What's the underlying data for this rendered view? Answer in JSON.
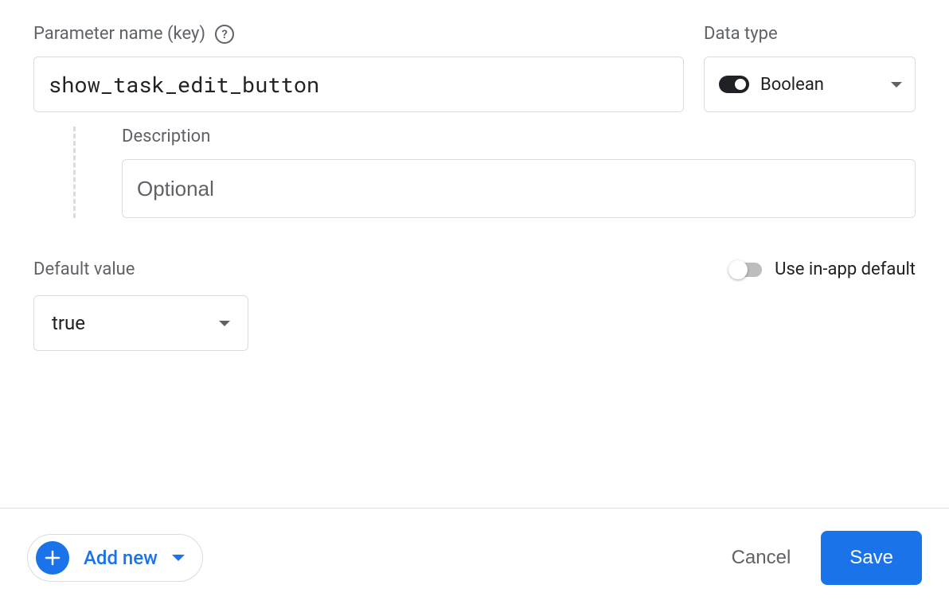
{
  "param": {
    "label": "Parameter name (key)",
    "value": "show_task_edit_button"
  },
  "datatype": {
    "label": "Data type",
    "selected": "Boolean"
  },
  "description": {
    "label": "Description",
    "placeholder": "Optional",
    "value": ""
  },
  "default_value": {
    "label": "Default value",
    "selected": "true"
  },
  "inapp": {
    "label": "Use in-app default",
    "enabled": false
  },
  "footer": {
    "add_new": "Add new",
    "cancel": "Cancel",
    "save": "Save"
  }
}
